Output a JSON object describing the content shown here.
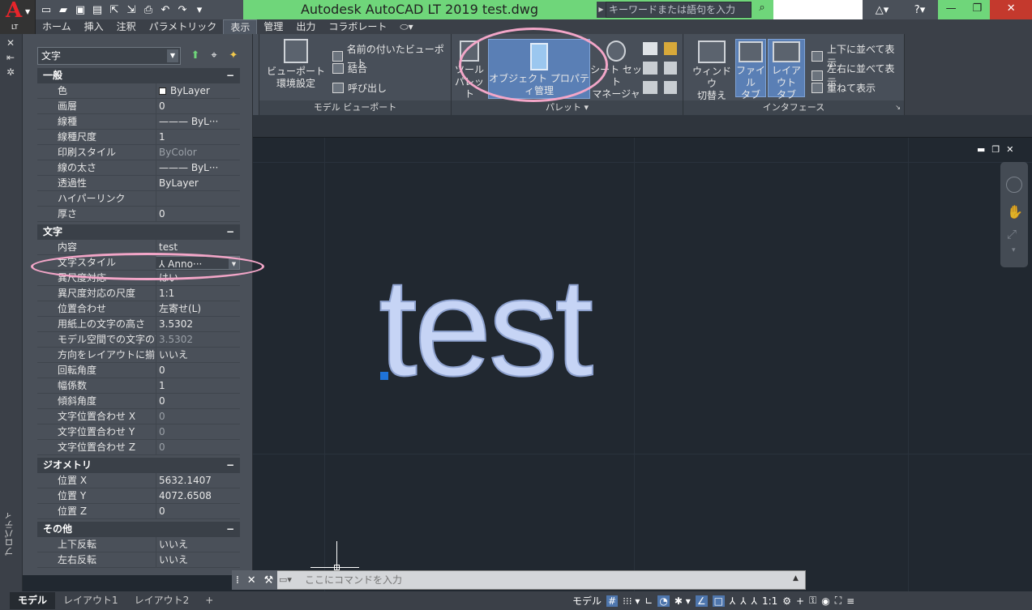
{
  "app": {
    "title": "Autodesk AutoCAD LT 2019    test.dwg",
    "logo_letter": "A",
    "logo_sub": "LT"
  },
  "search": {
    "placeholder": "キーワードまたは語句を入力"
  },
  "tabs": [
    "ホーム",
    "挿入",
    "注釈",
    "パラメトリック",
    "表示",
    "管理",
    "出力",
    "コラボレート"
  ],
  "active_tab": "表示",
  "ribbon": {
    "viewport_btn": "ビューポート\n環境設定",
    "named_vp": "名前の付いたビューポート",
    "join": "結合",
    "callout": "呼び出し",
    "model_vp_panel": "モデル ビューポート",
    "tool_palette": "ツール\nパレット",
    "opm": "オブジェクト プロパティ管理",
    "sheetset": "シート セット\nマネージャ",
    "palette_panel": "パレット",
    "window_switch": "ウィンドウ\n切替え",
    "file_tab": "ファイル\nタブ",
    "layout_tab": "レイアウト\nタブ",
    "tile_v": "上下に並べて表示",
    "tile_h": "左右に並べて表示",
    "cascade": "重ねて表示",
    "interface_panel": "インタフェース"
  },
  "properties": {
    "selector": "文字",
    "sections": {
      "general": "一般",
      "text": "文字",
      "geometry": "ジオメトリ",
      "misc": "その他"
    },
    "general": [
      {
        "k": "色",
        "v": "ByLayer"
      },
      {
        "k": "画層",
        "v": "0"
      },
      {
        "k": "線種",
        "v": "——— ByL···"
      },
      {
        "k": "線種尺度",
        "v": "1"
      },
      {
        "k": "印刷スタイル",
        "v": "ByColor"
      },
      {
        "k": "線の太さ",
        "v": "——— ByL···"
      },
      {
        "k": "透過性",
        "v": "ByLayer"
      },
      {
        "k": "ハイパーリンク",
        "v": ""
      },
      {
        "k": "厚さ",
        "v": "0"
      }
    ],
    "text": [
      {
        "k": "内容",
        "v": "test"
      },
      {
        "k": "文字スタイル",
        "v": "Anno···"
      },
      {
        "k": "異尺度対応",
        "v": "はい"
      },
      {
        "k": "異尺度対応の尺度",
        "v": "1:1"
      },
      {
        "k": "位置合わせ",
        "v": "左寄せ(L)"
      },
      {
        "k": "用紙上の文字の高さ",
        "v": "3.5302"
      },
      {
        "k": "モデル空間での文字の高さ",
        "v": "3.5302"
      },
      {
        "k": "方向をレイアウトに揃える",
        "v": "いいえ"
      },
      {
        "k": "回転角度",
        "v": "0"
      },
      {
        "k": "幅係数",
        "v": "1"
      },
      {
        "k": "傾斜角度",
        "v": "0"
      },
      {
        "k": "文字位置合わせ X",
        "v": "0"
      },
      {
        "k": "文字位置合わせ Y",
        "v": "0"
      },
      {
        "k": "文字位置合わせ Z",
        "v": "0"
      }
    ],
    "geometry": [
      {
        "k": "位置 X",
        "v": "5632.1407"
      },
      {
        "k": "位置 Y",
        "v": "4072.6508"
      },
      {
        "k": "位置 Z",
        "v": "0"
      }
    ],
    "misc": [
      {
        "k": "上下反転",
        "v": "いいえ"
      },
      {
        "k": "左右反転",
        "v": "いいえ"
      }
    ],
    "palette_title": "プロパティ"
  },
  "drawing": {
    "text": "test"
  },
  "command": {
    "placeholder": "ここにコマンドを入力"
  },
  "layout_tabs": [
    "モデル",
    "レイアウト1",
    "レイアウト2"
  ],
  "status": {
    "model": "モデル",
    "scale": "1:1"
  },
  "colors": {
    "title_green": "#6fd67a",
    "accent": "#5a7fb5",
    "highlight": "#f3a6c8"
  }
}
